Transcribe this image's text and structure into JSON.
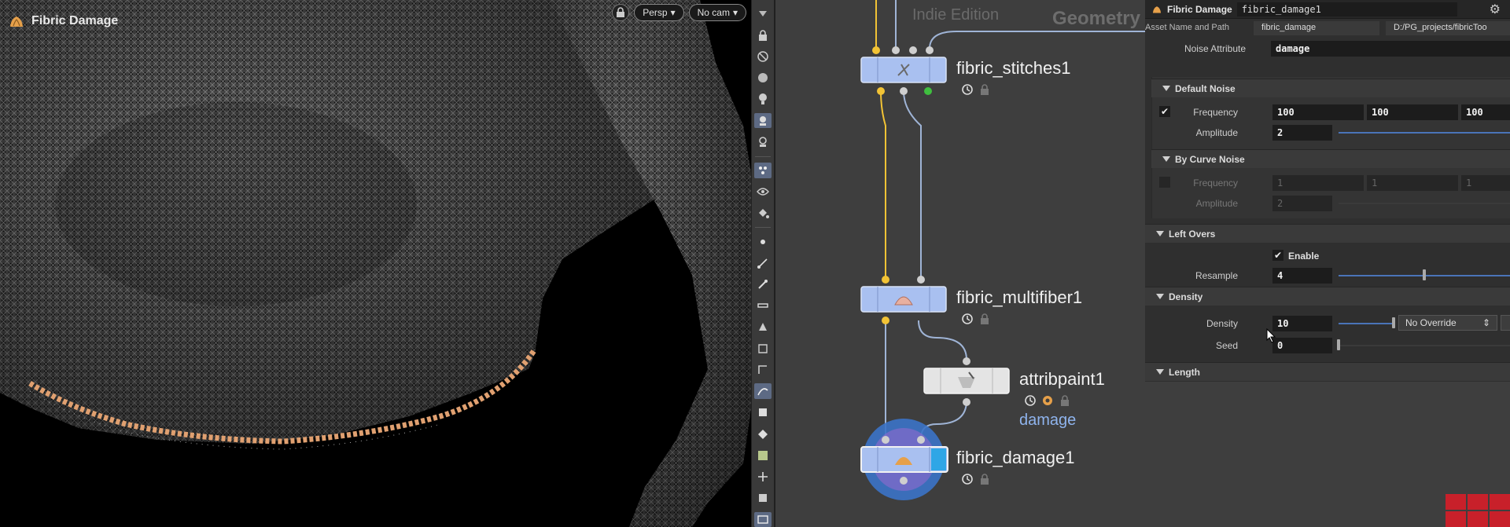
{
  "viewport": {
    "title": "Fibric Damage",
    "persp_label": "Persp",
    "cam_label": "No cam"
  },
  "network": {
    "tag_indie": "Indie Edition",
    "tag_context": "Geometry",
    "nodes": [
      {
        "label": "fibric_stitches1"
      },
      {
        "label": "fibric_multifiber1"
      },
      {
        "label": "attribpaint1",
        "attribute": "damage"
      },
      {
        "label": "fibric_damage1"
      }
    ]
  },
  "params": {
    "op_type": "Fibric Damage",
    "node_name": "fibric_damage1",
    "asset_label": "Asset Name and Path",
    "asset_name": "fibric_damage",
    "asset_path": "D:/PG_projects/fibricToo",
    "noise_attr_label": "Noise Attribute",
    "noise_attr_value": "damage",
    "folders": {
      "default_noise": "Default Noise",
      "by_curve_noise": "By Curve Noise",
      "left_overs": "Left Overs",
      "density": "Density",
      "length": "Length"
    },
    "default_noise": {
      "frequency_label": "Frequency",
      "frequency": [
        "100",
        "100",
        "100"
      ],
      "amplitude_label": "Amplitude",
      "amplitude": "2",
      "amplitude_fill": 1.0
    },
    "by_curve_noise": {
      "frequency_label": "Frequency",
      "frequency": [
        "1",
        "1",
        "1"
      ],
      "amplitude_label": "Amplitude",
      "amplitude": "2"
    },
    "left_overs": {
      "enable_label": "Enable",
      "resample_label": "Resample",
      "resample": "4",
      "resample_fill": 0.5
    },
    "density": {
      "density_label": "Density",
      "density": "10",
      "override": "No Override",
      "seed_label": "Seed",
      "seed": "0"
    }
  },
  "colors": {
    "accent": "#4a74b8",
    "wire_yellow": "#f2c335",
    "wire_blue": "#9fb4d6",
    "node_blue": "#a9c0f0"
  }
}
